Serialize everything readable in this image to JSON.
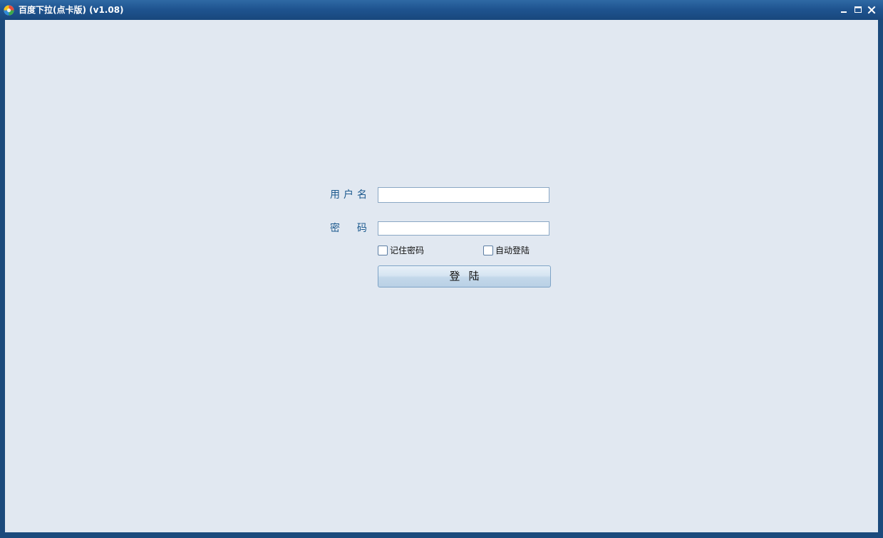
{
  "window": {
    "title": "百度下拉(点卡版) (v1.08)",
    "controls": {
      "minimize_icon": "minimize-icon",
      "maximize_icon": "maximize-icon",
      "close_icon": "close-icon"
    }
  },
  "login": {
    "username_label": "用户名",
    "password_label": "密  码",
    "username_value": "",
    "password_value": "",
    "remember_label": "记住密码",
    "remember_checked": false,
    "autologin_label": "自动登陆",
    "autologin_checked": false,
    "submit_label": "登陆"
  },
  "colors": {
    "titlebar": "#1f5490",
    "frame": "#1b4a7c",
    "content_bg": "#e1e8f1",
    "label_text": "#1d5a8e",
    "input_border": "#8aa7c4",
    "button_border": "#7ea3c6"
  }
}
